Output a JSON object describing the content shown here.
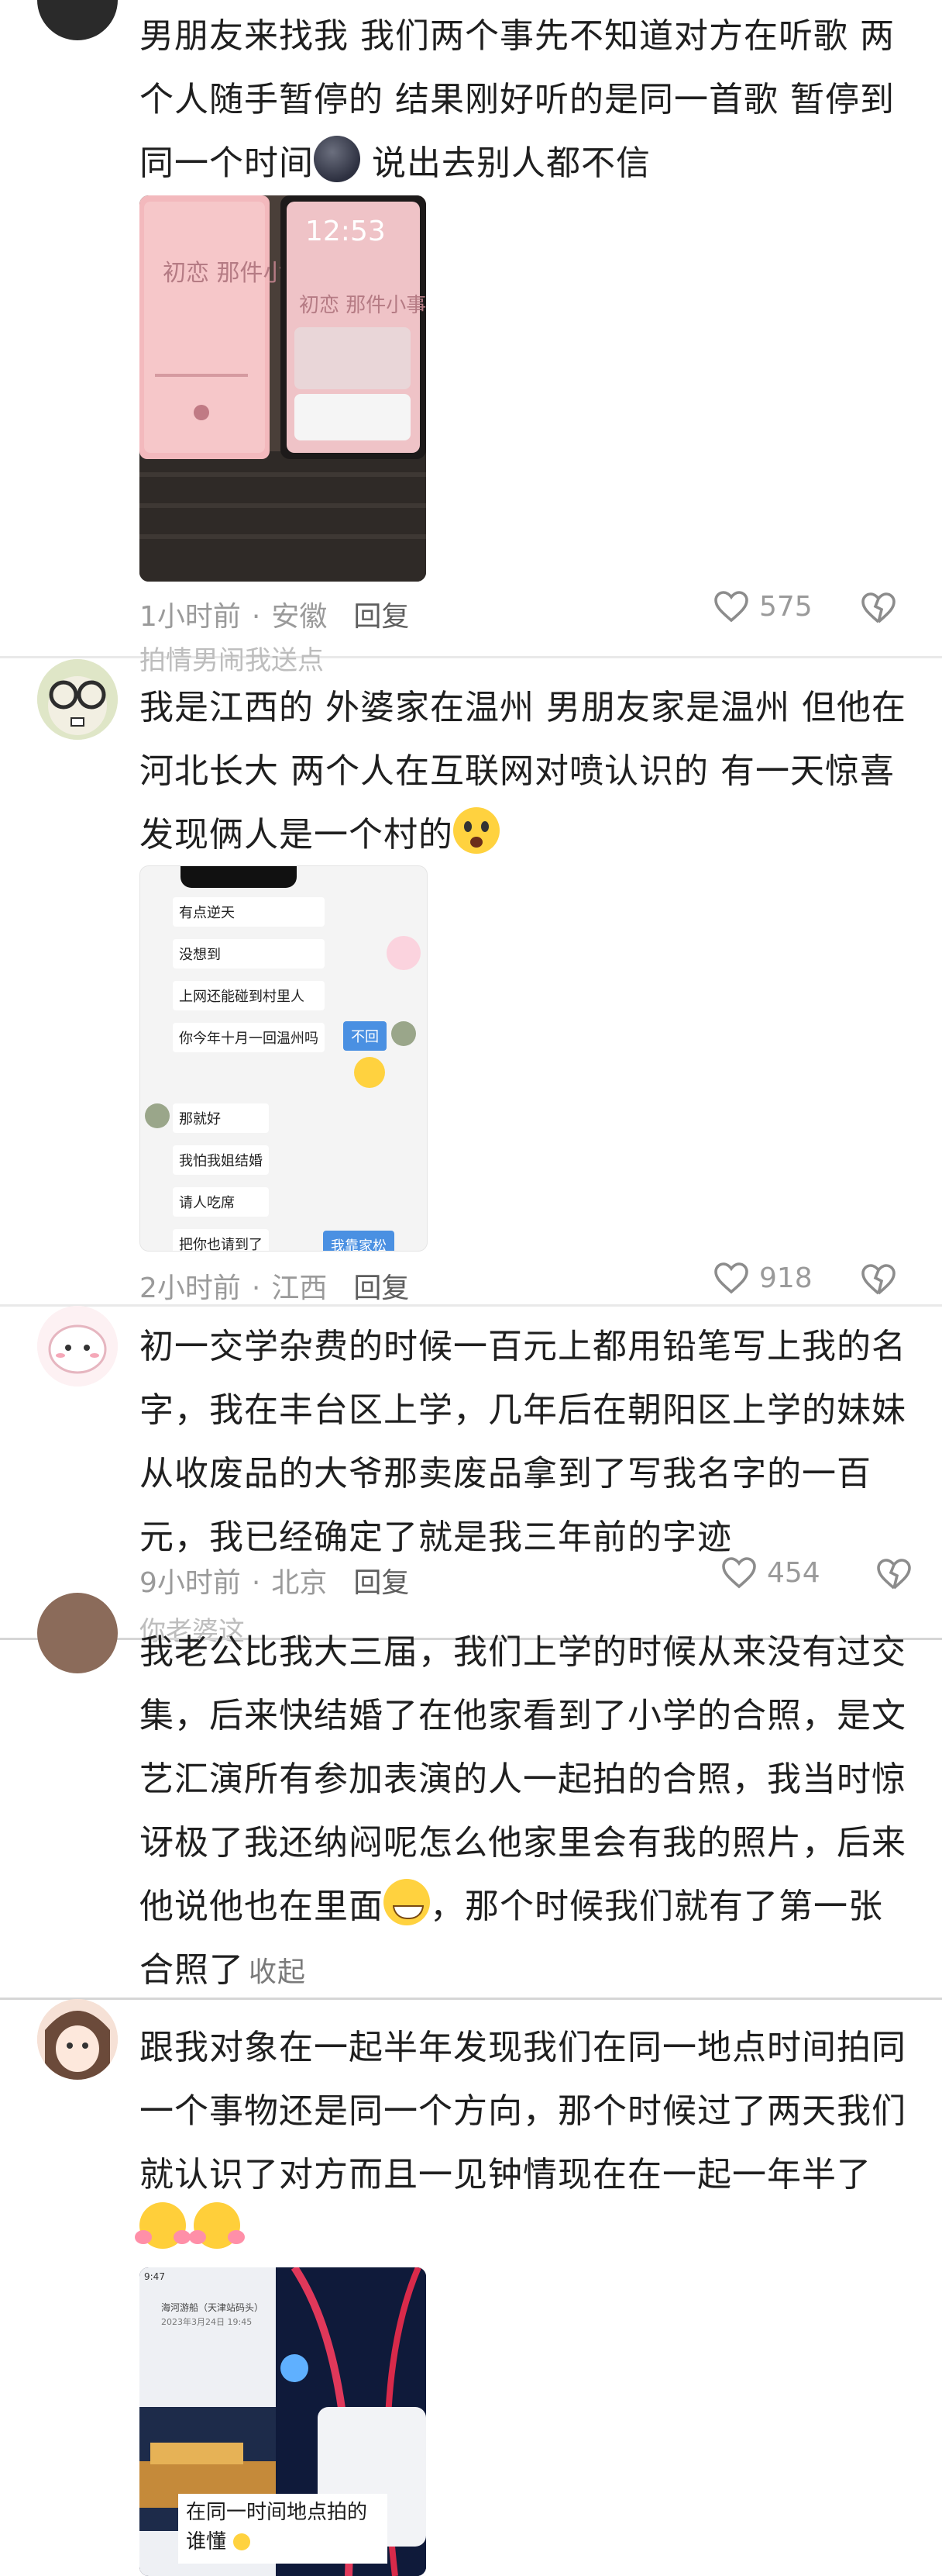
{
  "comments": [
    {
      "text": "男朋友来找我 我们两个事先不知道对方在听歌 两个人随手暂停的 结果刚好听的是同一首歌 暂停到同一个时间",
      "text_tail": " 说出去别人都不信",
      "time": "1小时前",
      "location": "安徽",
      "reply": "回复",
      "likes": "575",
      "image": {
        "clock": "12:53",
        "song_title": "初恋 那件小事"
      }
    },
    {
      "partial_name": "拍情男闹我送点",
      "text": "我是江西的 外婆家在温州 男朋友家是温州 但他在河北长大 两个人在互联网对喷认识的 有一天惊喜发现俩人是一个村的",
      "time": "2小时前",
      "location": "江西",
      "reply": "回复",
      "likes": "918",
      "chat": {
        "left_msgs": [
          "有点逆天",
          "没想到",
          "上网还能碰到村里人",
          "你今年十月一回温州吗"
        ],
        "right_msg": "不回",
        "left_msgs2": [
          "那就好",
          "我怕我姐结婚",
          "请人吃席",
          "把你也请到了"
        ],
        "right_bottom": "我靠家松"
      }
    },
    {
      "text": "初一交学杂费的时候一百元上都用铅笔写上我的名字，我在丰台区上学，几年后在朝阳区上学的妹妹从收废品的大爷那卖废品拿到了写我名字的一百元，我已经确定了就是我三年前的字迹",
      "time": "9小时前",
      "location": "北京",
      "reply": "回复",
      "likes": "454",
      "partial_next": "你老婆这"
    },
    {
      "text": "我老公比我大三届，我们上学的时候从来没有过交集，后来快结婚了在他家看到了小学的合照，是文艺汇演所有参加表演的人一起拍的合照，我当时惊讶极了我还纳闷呢怎么他家里会有我的照片，后来他说他也在里面",
      "text_tail": "，那个时候我们就有了第一张合照了",
      "fold": "收起"
    },
    {
      "text": "跟我对象在一起半年发现我们在同一地点时间拍同一个事物还是同一个方向，那个时候过了两天我们就认识了对方而且一见钟情现在在一起一年半了",
      "image": {
        "status_time": "9:47",
        "top_label": "海河游船（天津站码头）",
        "date_label": "2023年3月24日 19:45",
        "caption_line1": "在同一时间地点拍的",
        "caption_line2": "谁懂"
      }
    }
  ]
}
